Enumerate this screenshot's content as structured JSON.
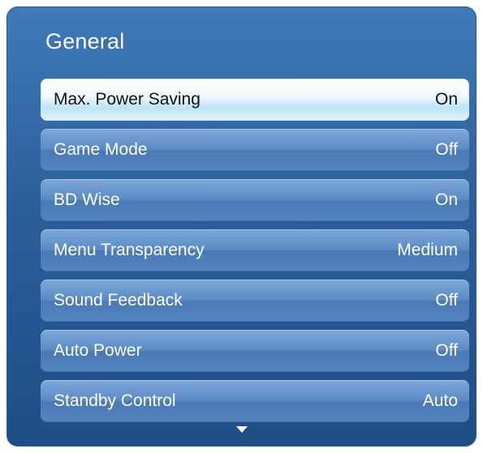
{
  "panel": {
    "title": "General"
  },
  "menu": {
    "items": [
      {
        "label": "Max. Power Saving",
        "value": "On",
        "selected": true
      },
      {
        "label": "Game Mode",
        "value": "Off",
        "selected": false
      },
      {
        "label": "BD Wise",
        "value": "On",
        "selected": false
      },
      {
        "label": "Menu Transparency",
        "value": "Medium",
        "selected": false
      },
      {
        "label": "Sound Feedback",
        "value": "Off",
        "selected": false
      },
      {
        "label": "Auto Power",
        "value": "Off",
        "selected": false
      },
      {
        "label": "Standby Control",
        "value": "Auto",
        "selected": false
      }
    ]
  },
  "icons": {
    "scroll_down": "chevron-down-icon"
  },
  "colors": {
    "panel_top": "#3e7ab8",
    "panel_bottom": "#1f4d86",
    "item": "#5b8bc6",
    "item_selected": "#d7eefb",
    "text": "#ffffff",
    "text_selected": "#111111"
  }
}
